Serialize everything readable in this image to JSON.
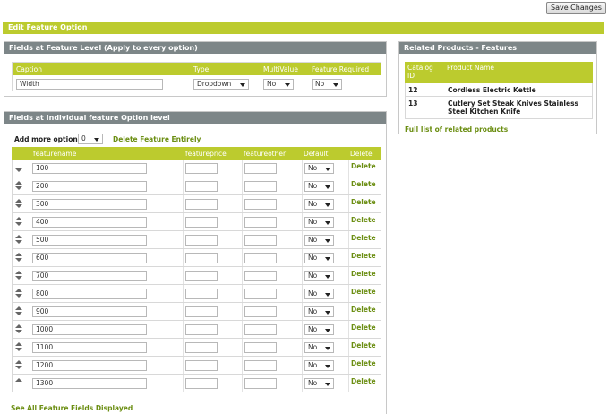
{
  "toolbar": {
    "save_label": "Save Changes"
  },
  "main": {
    "title": "Edit Feature Option"
  },
  "feature_level": {
    "title": "Fields at Feature Level (Apply to every option)",
    "headers": {
      "caption": "Caption",
      "type": "Type",
      "multivalue": "MultiValue",
      "required": "Feature Required"
    },
    "caption_value": "Width",
    "type_value": "Dropdown",
    "multivalue_value": "No",
    "required_value": "No"
  },
  "option_level": {
    "title": "Fields at Individual feature Option level",
    "add_more_label": "Add more options",
    "add_more_value": "0",
    "delete_feature_label": "Delete Feature Entirely",
    "headers": {
      "name": "featurename",
      "price": "featureprice",
      "other": "featureother",
      "default": "Default",
      "delete": "Delete"
    },
    "rows": [
      {
        "name": "100",
        "default": "No",
        "delete": "Delete"
      },
      {
        "name": "200",
        "default": "No",
        "delete": "Delete"
      },
      {
        "name": "300",
        "default": "No",
        "delete": "Delete"
      },
      {
        "name": "400",
        "default": "No",
        "delete": "Delete"
      },
      {
        "name": "500",
        "default": "No",
        "delete": "Delete"
      },
      {
        "name": "600",
        "default": "No",
        "delete": "Delete"
      },
      {
        "name": "700",
        "default": "No",
        "delete": "Delete"
      },
      {
        "name": "800",
        "default": "No",
        "delete": "Delete"
      },
      {
        "name": "900",
        "default": "No",
        "delete": "Delete"
      },
      {
        "name": "1000",
        "default": "No",
        "delete": "Delete"
      },
      {
        "name": "1100",
        "default": "No",
        "delete": "Delete"
      },
      {
        "name": "1200",
        "default": "No",
        "delete": "Delete"
      },
      {
        "name": "1300",
        "default": "No",
        "delete": "Delete"
      }
    ],
    "see_all_label": "See All Feature Fields Displayed"
  },
  "related": {
    "title": "Related Products - Features",
    "headers": {
      "id": "Catalog ID",
      "name": "Product Name"
    },
    "rows": [
      {
        "id": "12",
        "name": "Cordless Electric Kettle"
      },
      {
        "id": "13",
        "name": "Cutlery Set Steak Knives Stainless Steel Kitchen Knife"
      }
    ],
    "full_list_label": "Full list of related products"
  },
  "icons": {
    "reorder": "reorder-arrows-icon",
    "dropdown": "chevron-down-icon"
  },
  "colors": {
    "accent": "#bccb2e",
    "panel_header": "#7d8688",
    "link": "#6b8e12"
  }
}
